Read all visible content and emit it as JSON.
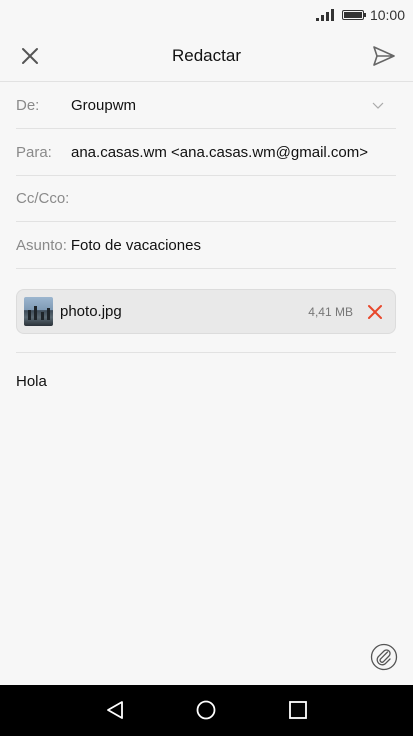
{
  "status_bar": {
    "time": "10:00"
  },
  "toolbar": {
    "title": "Redactar"
  },
  "fields": {
    "from_label": "De:",
    "from_value": "Groupwm",
    "to_label": "Para:",
    "to_value": "ana.casas.wm <ana.casas.wm@gmail.com>",
    "cc_label": "Cc/Cco:",
    "subject_label": "Asunto:",
    "subject_value": "Foto de vacaciones"
  },
  "attachment": {
    "name": "photo.jpg",
    "size": "4,41 MB"
  },
  "body": {
    "text": "Hola"
  },
  "colors": {
    "remove_accent": "#e8472b",
    "navbar": "#000000"
  }
}
